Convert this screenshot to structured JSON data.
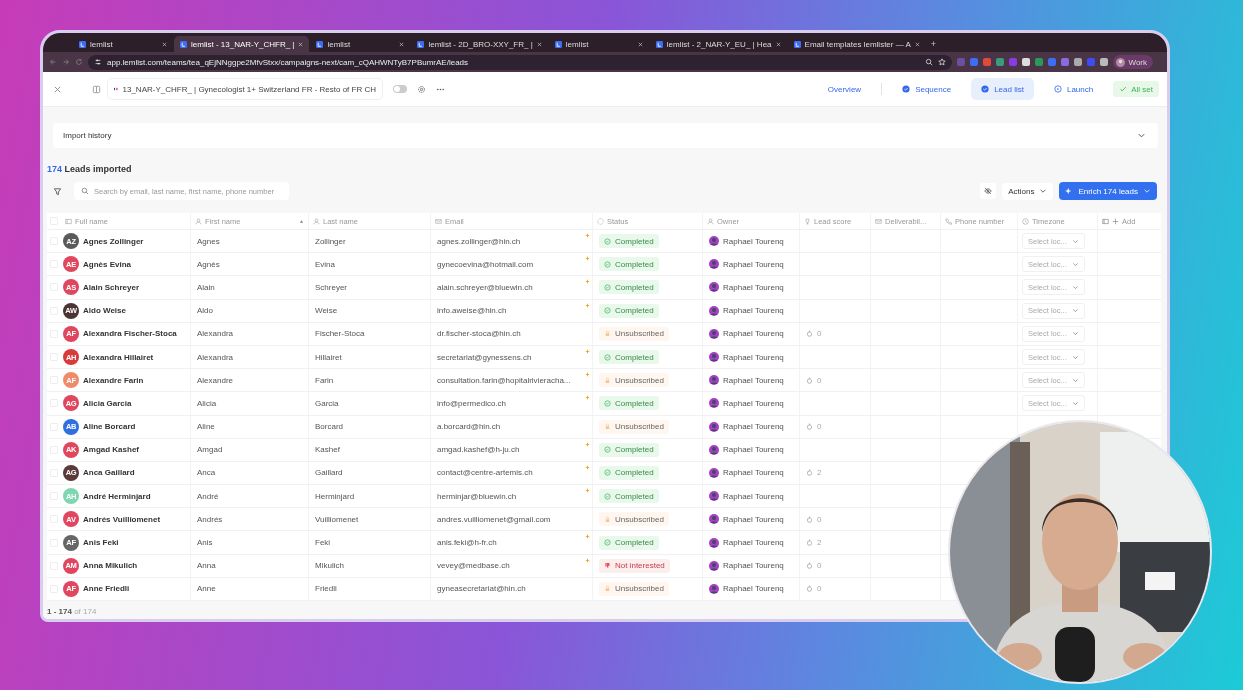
{
  "browser": {
    "tabs": [
      {
        "title": "lemlist",
        "selected": false
      },
      {
        "title": "lemlist - 13_NAR-Y_CHFR_ |",
        "selected": true
      },
      {
        "title": "lemlist",
        "selected": false
      },
      {
        "title": "lemlist - 2D_BRO-XXY_FR_ |",
        "selected": false
      },
      {
        "title": "lemlist",
        "selected": false
      },
      {
        "title": "lemlist - 2_NAR-Y_EU_ | Hea",
        "selected": false
      },
      {
        "title": "Email templates lemlister — A",
        "selected": false
      }
    ],
    "new_tab": "+",
    "url": "app.lemlist.com/teams/tea_qEjNNggpe2MfvStxx/campaigns-next/cam_cQAHWNTyB7PBumrAE/leads",
    "profile": "Work"
  },
  "header": {
    "campaign": "13_NAR-Y_CHFR_ | Gynecologist 1+ Switzerland FR - Resto of FR CH",
    "toggle_on": false,
    "steps": [
      {
        "label": "Overview",
        "selected": false,
        "kind": "plain"
      },
      {
        "label": "Sequence",
        "done": true,
        "selected": false,
        "kind": "step"
      },
      {
        "label": "Lead list",
        "done": true,
        "selected": true,
        "kind": "step"
      },
      {
        "label": "Launch",
        "done": false,
        "selected": false,
        "kind": "step"
      }
    ],
    "status_badge": "All set"
  },
  "import_history": {
    "title": "Import history",
    "expanded": false
  },
  "leads": {
    "count": "174",
    "label": "Leads imported"
  },
  "toolbar": {
    "search_placeholder": "Search by email, last name, first name, phone number",
    "actions": "Actions",
    "enrich": "Enrich 174 leads"
  },
  "table": {
    "select_all_checked": false,
    "columns": [
      {
        "label": "Full name",
        "sorted": false
      },
      {
        "label": "First name",
        "sorted": true
      },
      {
        "label": "Last name",
        "sorted": false
      },
      {
        "label": "Email",
        "sorted": false
      },
      {
        "label": "Status",
        "sorted": false
      },
      {
        "label": "Owner",
        "sorted": false
      },
      {
        "label": "Lead score",
        "sorted": false
      },
      {
        "label": "Deliverabil...",
        "sorted": false
      },
      {
        "label": "Phone number",
        "sorted": false
      },
      {
        "label": "Timezone",
        "sorted": false
      },
      {
        "label": "Add",
        "sorted": false
      }
    ],
    "rows": [
      {
        "checked": false,
        "initials": "AZ",
        "color": "#5a5a5a",
        "full_name": "Agnes Zollinger",
        "first_name": "Agnes",
        "last_name": "Zollinger",
        "email": "agnes.zollinger@hin.ch",
        "starred": true,
        "status": {
          "kind": "completed",
          "label": "Completed"
        },
        "owner": "Raphael Tourenq",
        "timezone": "Select loc..."
      },
      {
        "checked": false,
        "initials": "AE",
        "color": "#e0475e",
        "full_name": "Agnès Evina",
        "first_name": "Agnès",
        "last_name": "Evina",
        "email": "gynecoevina@hotmail.com",
        "starred": true,
        "status": {
          "kind": "completed",
          "label": "Completed"
        },
        "owner": "Raphael Tourenq",
        "timezone": "Select loc..."
      },
      {
        "checked": false,
        "initials": "AS",
        "color": "#e0475e",
        "full_name": "Alain Schreyer",
        "first_name": "Alain",
        "last_name": "Schreyer",
        "email": "alain.schreyer@bluewin.ch",
        "starred": true,
        "status": {
          "kind": "completed",
          "label": "Completed"
        },
        "owner": "Raphael Tourenq",
        "timezone": "Select loc..."
      },
      {
        "checked": false,
        "initials": "AW",
        "color": "#4a3434",
        "full_name": "Aldo Weise",
        "first_name": "Aldo",
        "last_name": "Weise",
        "email": "info.aweise@hin.ch",
        "starred": true,
        "status": {
          "kind": "completed",
          "label": "Completed"
        },
        "owner": "Raphael Tourenq",
        "timezone": "Select loc..."
      },
      {
        "checked": false,
        "initials": "AF",
        "color": "#e0475e",
        "full_name": "Alexandra Fischer-Stoca",
        "first_name": "Alexandra",
        "last_name": "Fischer-Stoca",
        "email": "dr.fischer-stoca@hin.ch",
        "starred": false,
        "status": {
          "kind": "unsubscribed",
          "label": "Unsubscribed"
        },
        "owner": "Raphael Tourenq",
        "lead_score": "0",
        "timezone": "Select loc..."
      },
      {
        "checked": false,
        "initials": "AH",
        "color": "#d93a3a",
        "full_name": "Alexandra Hillairet",
        "first_name": "Alexandra",
        "last_name": "Hillairet",
        "email": "secretariat@gynessens.ch",
        "starred": true,
        "status": {
          "kind": "completed",
          "label": "Completed"
        },
        "owner": "Raphael Tourenq",
        "timezone": "Select loc..."
      },
      {
        "checked": false,
        "initials": "AF",
        "color": "#ef8b6b",
        "full_name": "Alexandre Farin",
        "first_name": "Alexandre",
        "last_name": "Farin",
        "email": "consultation.farin@hopitalrivieracha...",
        "starred": true,
        "status": {
          "kind": "unsubscribed",
          "label": "Unsubscribed"
        },
        "owner": "Raphael Tourenq",
        "lead_score": "0",
        "timezone": "Select loc..."
      },
      {
        "checked": false,
        "initials": "AG",
        "color": "#e0475e",
        "full_name": "Alicia Garcia",
        "first_name": "Alicia",
        "last_name": "Garcia",
        "email": "info@permedico.ch",
        "starred": true,
        "status": {
          "kind": "completed",
          "label": "Completed"
        },
        "owner": "Raphael Tourenq",
        "timezone": "Select loc..."
      },
      {
        "checked": false,
        "initials": "AB",
        "color": "#2f6fe0",
        "full_name": "Aline Borcard",
        "first_name": "Aline",
        "last_name": "Borcard",
        "email": "a.borcard@hin.ch",
        "starred": false,
        "status": {
          "kind": "unsubscribed",
          "label": "Unsubscribed"
        },
        "owner": "Raphael Tourenq",
        "lead_score": "0"
      },
      {
        "checked": false,
        "initials": "AK",
        "color": "#e0475e",
        "full_name": "Amgad Kashef",
        "first_name": "Amgad",
        "last_name": "Kashef",
        "email": "amgad.kashef@h-ju.ch",
        "starred": true,
        "status": {
          "kind": "completed",
          "label": "Completed"
        },
        "owner": "Raphael Tourenq"
      },
      {
        "checked": false,
        "initials": "AG",
        "color": "#5a3a3a",
        "full_name": "Anca Gaillard",
        "first_name": "Anca",
        "last_name": "Gaillard",
        "email": "contact@centre-artemis.ch",
        "starred": true,
        "status": {
          "kind": "completed",
          "label": "Completed"
        },
        "owner": "Raphael Tourenq",
        "lead_score": "2"
      },
      {
        "checked": false,
        "initials": "AH",
        "color": "#7fd6b0",
        "full_name": "André Herminjard",
        "first_name": "André",
        "last_name": "Herminjard",
        "email": "herminjar@bluewin.ch",
        "starred": true,
        "status": {
          "kind": "completed",
          "label": "Completed"
        },
        "owner": "Raphael Tourenq"
      },
      {
        "checked": false,
        "initials": "AV",
        "color": "#e0475e",
        "full_name": "Andrés Vuilliomenet",
        "first_name": "Andrés",
        "last_name": "Vuilliomenet",
        "email": "andres.vuilliomenet@gmail.com",
        "starred": false,
        "status": {
          "kind": "unsubscribed",
          "label": "Unsubscribed"
        },
        "owner": "Raphael Tourenq",
        "lead_score": "0"
      },
      {
        "checked": false,
        "initials": "AF",
        "color": "#666666",
        "full_name": "Anis Feki",
        "first_name": "Anis",
        "last_name": "Feki",
        "email": "anis.feki@h-fr.ch",
        "starred": true,
        "status": {
          "kind": "completed",
          "label": "Completed"
        },
        "owner": "Raphael Tourenq",
        "lead_score": "2"
      },
      {
        "checked": false,
        "initials": "AM",
        "color": "#e0475e",
        "full_name": "Anna Mikulich",
        "first_name": "Anna",
        "last_name": "Mikulich",
        "email": "vevey@medbase.ch",
        "starred": true,
        "status": {
          "kind": "not_interested",
          "label": "Not interested"
        },
        "owner": "Raphael Tourenq",
        "lead_score": "0"
      },
      {
        "checked": false,
        "initials": "AF",
        "color": "#e0475e",
        "full_name": "Anne Friedli",
        "first_name": "Anne",
        "last_name": "Friedli",
        "email": "gyneasecretariat@hin.ch",
        "starred": false,
        "status": {
          "kind": "unsubscribed",
          "label": "Unsubscribed"
        },
        "owner": "Raphael Tourenq",
        "lead_score": "0"
      }
    ]
  },
  "pager": "**1 - 174** of 174"
}
